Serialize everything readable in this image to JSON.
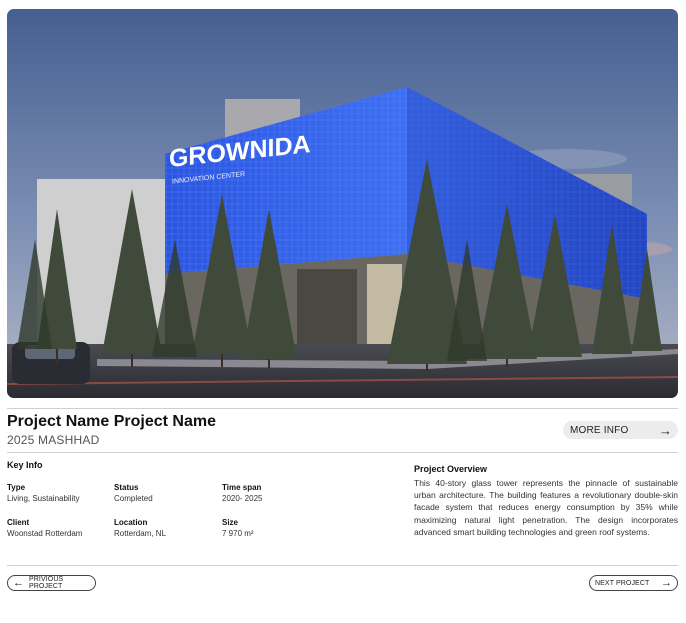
{
  "hero": {
    "building_sign": "GROWNIDA",
    "building_subsign": "INNOVATION CENTER",
    "colors": {
      "sky_top": "#4a6596",
      "sky_bottom": "#a9b4c9",
      "facade": "#2f5fe8",
      "ground": "#3c3c44"
    }
  },
  "project": {
    "title": "Project Name Project Name",
    "subtitle": "2025 MASHHAD",
    "more_info_label": "MORE INFO",
    "more_info_icon": "arrow-right-icon"
  },
  "key_info": {
    "heading": "Key Info",
    "fields": [
      {
        "key": "Type",
        "value": "Living, Sustainability"
      },
      {
        "key": "Status",
        "value": "Completed"
      },
      {
        "key": "Time span",
        "value": "2020- 2025"
      },
      {
        "key": "Client",
        "value": "Woonstad Rotterdam"
      },
      {
        "key": "Location",
        "value": "Rotterdam, NL"
      },
      {
        "key": "Size",
        "value": "7 970 m²"
      }
    ]
  },
  "overview": {
    "heading": "Project Overview",
    "text": "This 40-story glass tower represents the pinnacle of sustainable urban architecture. The building features a revolutionary double-skin facade system that reduces energy consumption by 35% while maximizing natural light penetration. The design incorporates advanced smart building technologies and green roof systems."
  },
  "nav": {
    "previous_label": "PRIVIOUS PROJECT",
    "next_label": "NEXT PROJECT",
    "previous_icon": "arrow-left-icon",
    "next_icon": "arrow-right-icon"
  }
}
